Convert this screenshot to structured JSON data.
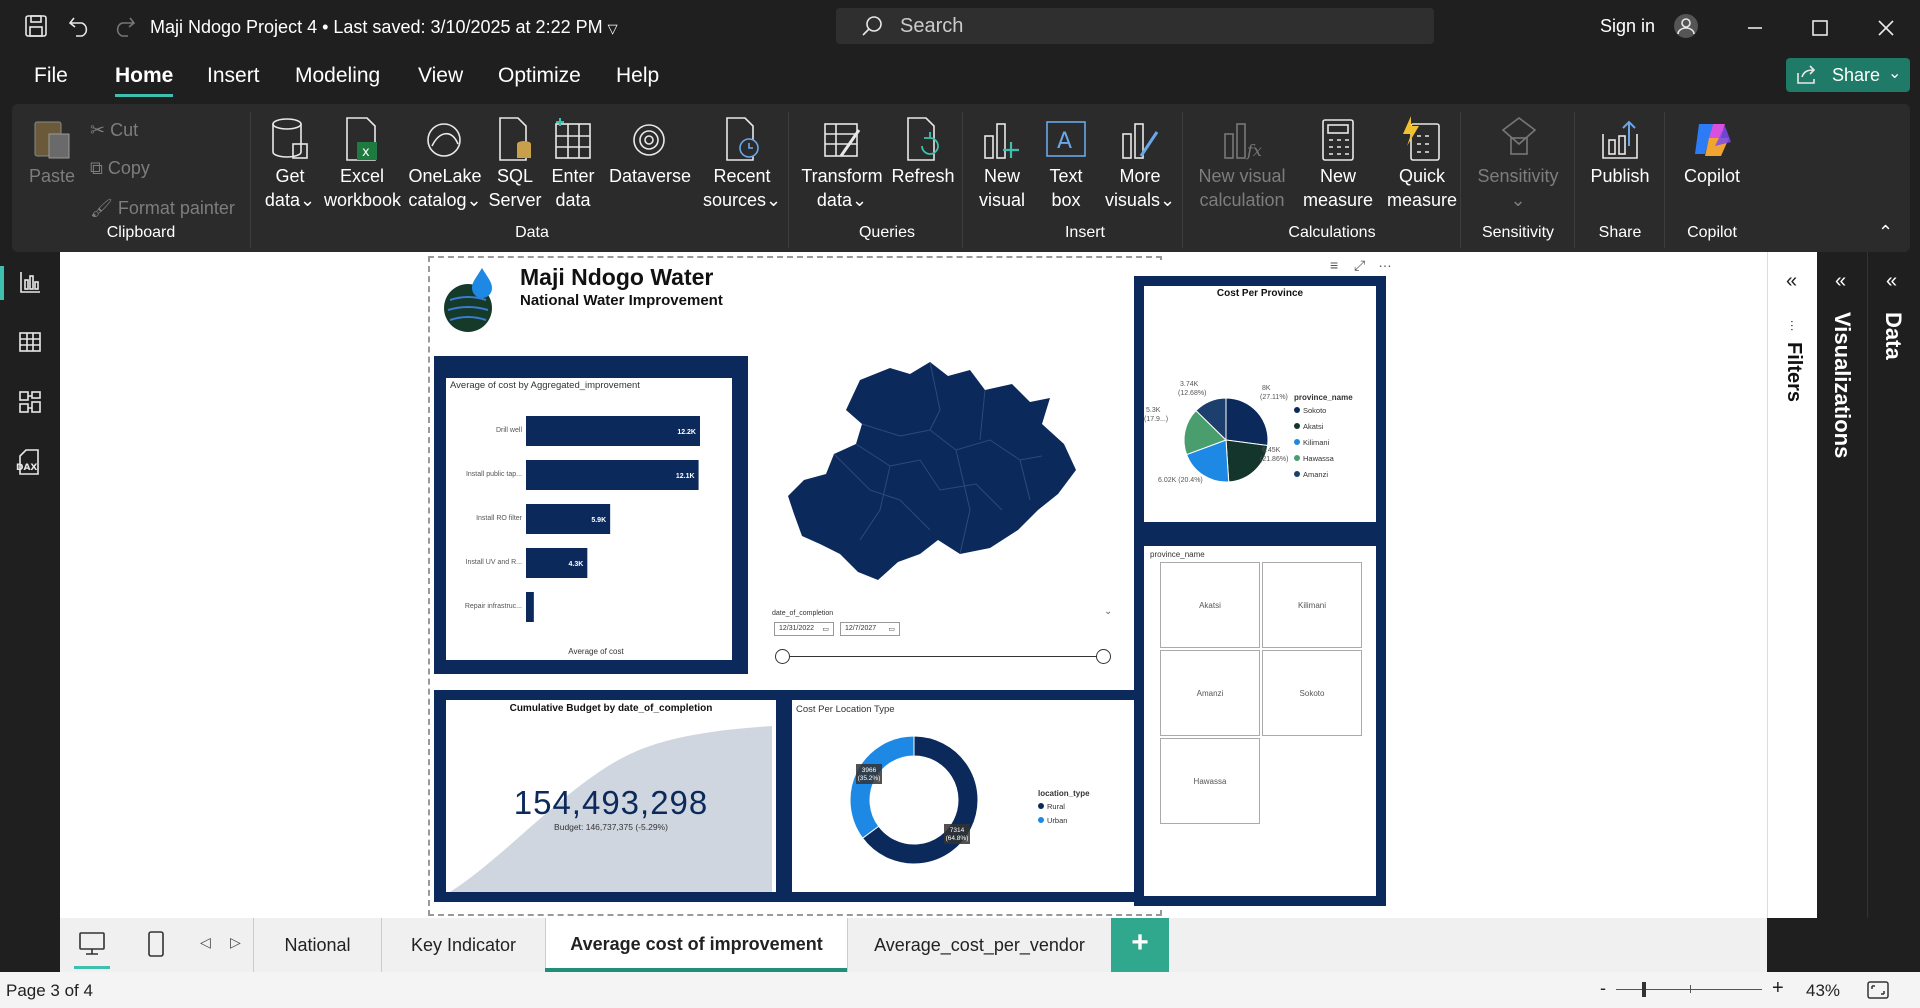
{
  "app": {
    "title": "Maji Ndogo Project 4",
    "saved": "Last saved: 3/10/2025 at 2:22 PM",
    "search_placeholder": "Search",
    "sign_in": "Sign in",
    "share": "Share"
  },
  "menu": [
    "File",
    "Home",
    "Insert",
    "Modeling",
    "View",
    "Optimize",
    "Help"
  ],
  "ribbon": {
    "clipboard": {
      "paste": "Paste",
      "cut": "Cut",
      "copy": "Copy",
      "format_painter": "Format painter",
      "group": "Clipboard"
    },
    "data": {
      "get_data": [
        "Get",
        "data"
      ],
      "excel": [
        "Excel",
        "workbook"
      ],
      "onelake": [
        "OneLake",
        "catalog"
      ],
      "sql": [
        "SQL",
        "Server"
      ],
      "enter": [
        "Enter",
        "data"
      ],
      "dataverse": "Dataverse",
      "recent": [
        "Recent",
        "sources"
      ],
      "group": "Data"
    },
    "queries": {
      "transform": [
        "Transform",
        "data"
      ],
      "refresh": "Refresh",
      "group": "Queries"
    },
    "insert": {
      "new_visual": [
        "New",
        "visual"
      ],
      "text_box": [
        "Text",
        "box"
      ],
      "more_visuals": [
        "More",
        "visuals"
      ],
      "group": "Insert"
    },
    "calculations": {
      "new_visual_calc": [
        "New visual",
        "calculation"
      ],
      "new_measure": [
        "New",
        "measure"
      ],
      "quick_measure": [
        "Quick",
        "measure"
      ],
      "group": "Calculations"
    },
    "sensitivity": {
      "label": "Sensitivity",
      "group": "Sensitivity"
    },
    "share": {
      "publish": "Publish",
      "group": "Share"
    },
    "copilot": {
      "label": "Copilot",
      "group": "Copilot"
    }
  },
  "report": {
    "title": "Maji Ndogo Water",
    "subtitle": "National Water Improvement",
    "slicer": {
      "label": "date_of_completion",
      "from": "12/31/2022",
      "to": "12/7/2027"
    },
    "kpi": {
      "title": "Cumulative Budget by date_of_completion",
      "value": "154,493,298",
      "sub": "Budget: 146,737,375 (-5.29%)"
    },
    "province_slicer": {
      "label": "province_name",
      "items": [
        "Akatsi",
        "Kilimani",
        "Amanzi",
        "Sokoto",
        "Hawassa"
      ]
    }
  },
  "chart_data": [
    {
      "type": "bar",
      "title": "Average of cost by Aggregated_improvement",
      "xlabel": "Average of cost",
      "ylabel": "",
      "categories": [
        "Drill well",
        "Install public tap...",
        "Install RO filter",
        "Install UV and R...",
        "Repair infrastruc..."
      ],
      "values": [
        12200,
        12100,
        5900,
        4300,
        550
      ],
      "labels": [
        "12.2K",
        "12.1K",
        "5.9K",
        "4.3K",
        ""
      ],
      "xlim": [
        0,
        12200
      ]
    },
    {
      "type": "pie",
      "title": "Cost Per Province",
      "legend_title": "province_name",
      "categories": [
        "Sokoto",
        "Akatsi",
        "Kilimani",
        "Hawassa",
        "Amanzi"
      ],
      "values": [
        8000,
        6450,
        6020,
        5300,
        3740
      ],
      "labels": [
        "8K (27.11%)",
        "6.45K (21.86%)",
        "6.02K (20.4%)",
        "5.3K (17.9...)",
        "3.74K (12.68%)"
      ],
      "colors": [
        "#0b2a5b",
        "#13352b",
        "#1e88e5",
        "#4a9e6e",
        "#1d3f6e"
      ]
    },
    {
      "type": "pie",
      "title": "Cost Per Location Type",
      "legend_title": "location_type",
      "categories": [
        "Rural",
        "Urban"
      ],
      "values": [
        7314,
        3966
      ],
      "labels": [
        "7314 (64.8%)",
        "3966 (35.2%)"
      ],
      "colors": [
        "#0b2a5b",
        "#1e88e5"
      ]
    }
  ],
  "panes": {
    "filters": "Filters",
    "visualizations": "Visualizations",
    "data": "Data"
  },
  "tabs": [
    "National",
    "Key Indicator",
    "Average cost of improvement",
    "Average_cost_per_vendor"
  ],
  "status": {
    "page": "Page 3 of 4",
    "zoom": "43%"
  }
}
